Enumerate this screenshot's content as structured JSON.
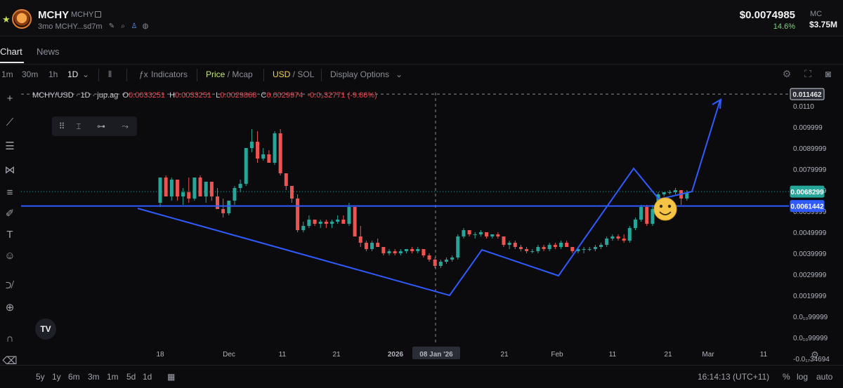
{
  "header": {
    "symbol": "MCHY",
    "symbol_sub": "MCHY",
    "age": "3mo",
    "address": "MCHY...sd7m",
    "price": "$0.0074985",
    "change": "14.6%",
    "mc_label": "MC",
    "mc_value": "$3.75M"
  },
  "tabs": [
    "Chart",
    "News"
  ],
  "toolbar": {
    "intervals": [
      "1m",
      "30m",
      "1h",
      "1D"
    ],
    "indicators": "Indicators",
    "price": "Price",
    "mcap": "Mcap",
    "usd": "USD",
    "sol": "SOL",
    "display_options": "Display Options"
  },
  "legend": {
    "title": "MCHY/USD · 1D · jup.ag",
    "o_label": "O",
    "o": "0.0033251",
    "h_label": "H",
    "h": "0.0033251",
    "l_label": "L",
    "l": "0.0029868",
    "c_label": "C",
    "c": "0.0029974",
    "chg": "-0.0₃32771 (-9.86%)"
  },
  "bottom": {
    "ranges": [
      "5y",
      "1y",
      "6m",
      "3m",
      "1m",
      "5d",
      "1d"
    ],
    "time": "16:14:13 (UTC+11)",
    "pct": "%",
    "log": "log",
    "auto": "auto"
  },
  "colors": {
    "up": "#26a69a",
    "down": "#ef5350",
    "drawing": "#2f5bff",
    "bg": "#0b0b0e"
  },
  "chart_data": {
    "type": "candlestick",
    "pair": "MCHY/USD",
    "interval": "1D",
    "y_ticks": [
      "0.0110",
      "0.009999",
      "0.0089999",
      "0.0079999",
      "0.0069999",
      "0.0059999",
      "0.0049999",
      "0.0039999",
      "0.0029999",
      "0.0019999",
      "0.0₁₀99999",
      "0.0₁₀99999",
      "-0.0₁₇34694"
    ],
    "x_ticks": [
      "18",
      "Dec",
      "11",
      "21",
      "2026",
      "08 Jan '26",
      "21",
      "Feb",
      "11",
      "21",
      "Mar",
      "11"
    ],
    "price_labels": [
      {
        "value": 0.011462,
        "text": "0.011462",
        "style": "crosshair"
      },
      {
        "value": 0.0068299,
        "text": "0.0068299",
        "style": "last"
      },
      {
        "value": 0.0061442,
        "text": "0.0061442",
        "style": "line"
      }
    ],
    "candles": [
      [
        0.0063,
        0.0075,
        0.0061,
        0.0075
      ],
      [
        0.0075,
        0.0076,
        0.0066,
        0.0066
      ],
      [
        0.0066,
        0.0075,
        0.0064,
        0.0074
      ],
      [
        0.0074,
        0.0074,
        0.0064,
        0.0066
      ],
      [
        0.0066,
        0.007,
        0.0062,
        0.0068
      ],
      [
        0.0068,
        0.0075,
        0.0063,
        0.0065
      ],
      [
        0.0065,
        0.0075,
        0.0064,
        0.0075
      ],
      [
        0.0075,
        0.0076,
        0.0066,
        0.0066
      ],
      [
        0.0066,
        0.0073,
        0.0063,
        0.0073
      ],
      [
        0.0073,
        0.0073,
        0.0064,
        0.0066
      ],
      [
        0.0066,
        0.007,
        0.006,
        0.006
      ],
      [
        0.006,
        0.0065,
        0.0056,
        0.0058
      ],
      [
        0.0058,
        0.0064,
        0.0057,
        0.0064
      ],
      [
        0.0064,
        0.0071,
        0.0062,
        0.007
      ],
      [
        0.007,
        0.0074,
        0.0068,
        0.0072
      ],
      [
        0.0072,
        0.0089,
        0.0071,
        0.0089
      ],
      [
        0.0089,
        0.0098,
        0.0087,
        0.0092
      ],
      [
        0.0092,
        0.0097,
        0.0082,
        0.0084
      ],
      [
        0.0084,
        0.0089,
        0.0083,
        0.0086
      ],
      [
        0.0086,
        0.0088,
        0.0082,
        0.0082
      ],
      [
        0.0082,
        0.0097,
        0.0081,
        0.0096
      ],
      [
        0.0096,
        0.0098,
        0.0076,
        0.0077
      ],
      [
        0.0077,
        0.0077,
        0.0069,
        0.0071
      ],
      [
        0.0071,
        0.0071,
        0.0063,
        0.0065
      ],
      [
        0.0065,
        0.0067,
        0.0049,
        0.005
      ],
      [
        0.005,
        0.0054,
        0.0049,
        0.0052
      ],
      [
        0.0052,
        0.0057,
        0.0051,
        0.0055
      ],
      [
        0.0055,
        0.0055,
        0.0052,
        0.0053
      ],
      [
        0.0053,
        0.0055,
        0.0051,
        0.0054
      ],
      [
        0.0054,
        0.0055,
        0.0051,
        0.0053
      ],
      [
        0.0053,
        0.0055,
        0.0051,
        0.0054
      ],
      [
        0.0054,
        0.0057,
        0.0053,
        0.0055
      ],
      [
        0.0055,
        0.0057,
        0.0053,
        0.0053
      ],
      [
        0.0053,
        0.0063,
        0.0052,
        0.0061
      ],
      [
        0.0061,
        0.0061,
        0.0047,
        0.0047
      ],
      [
        0.0047,
        0.0052,
        0.0042,
        0.0044
      ],
      [
        0.0044,
        0.0045,
        0.004,
        0.0041
      ],
      [
        0.0041,
        0.0045,
        0.004,
        0.0044
      ],
      [
        0.0044,
        0.0046,
        0.0042,
        0.0042
      ],
      [
        0.0042,
        0.0042,
        0.0038,
        0.0039
      ],
      [
        0.0039,
        0.0041,
        0.0038,
        0.004
      ],
      [
        0.004,
        0.0041,
        0.0038,
        0.0039
      ],
      [
        0.0039,
        0.0041,
        0.0038,
        0.004
      ],
      [
        0.004,
        0.0041,
        0.0039,
        0.0041
      ],
      [
        0.0041,
        0.0042,
        0.0039,
        0.004
      ],
      [
        0.004,
        0.0042,
        0.0039,
        0.0041
      ],
      [
        0.0041,
        0.0041,
        0.0037,
        0.0038
      ],
      [
        0.0038,
        0.0039,
        0.0035,
        0.0036
      ],
      [
        0.0036,
        0.0037,
        0.0032,
        0.0033
      ],
      [
        0.0033,
        0.0036,
        0.0032,
        0.0035
      ],
      [
        0.0035,
        0.0037,
        0.0034,
        0.0036
      ],
      [
        0.0036,
        0.0038,
        0.0035,
        0.0037
      ],
      [
        0.0037,
        0.0048,
        0.0036,
        0.0047
      ],
      [
        0.0047,
        0.0051,
        0.0046,
        0.005
      ],
      [
        0.005,
        0.005,
        0.0047,
        0.0048
      ],
      [
        0.0048,
        0.0049,
        0.0046,
        0.0048
      ],
      [
        0.0048,
        0.005,
        0.0047,
        0.0049
      ],
      [
        0.0049,
        0.0049,
        0.0046,
        0.0047
      ],
      [
        0.0047,
        0.0048,
        0.0046,
        0.0048
      ],
      [
        0.0048,
        0.0049,
        0.0046,
        0.0047
      ],
      [
        0.0047,
        0.0047,
        0.0042,
        0.0043
      ],
      [
        0.0043,
        0.0045,
        0.0041,
        0.0044
      ],
      [
        0.0044,
        0.0045,
        0.0041,
        0.0042
      ],
      [
        0.0042,
        0.0043,
        0.004,
        0.0041
      ],
      [
        0.0041,
        0.0042,
        0.0039,
        0.004
      ],
      [
        0.004,
        0.0041,
        0.0039,
        0.004
      ],
      [
        0.004,
        0.0043,
        0.0039,
        0.0042
      ],
      [
        0.0042,
        0.0043,
        0.004,
        0.0041
      ],
      [
        0.0041,
        0.0044,
        0.004,
        0.0043
      ],
      [
        0.0043,
        0.0044,
        0.0041,
        0.0042
      ],
      [
        0.0042,
        0.0045,
        0.0041,
        0.0044
      ],
      [
        0.0044,
        0.0045,
        0.0042,
        0.0042
      ],
      [
        0.0042,
        0.0042,
        0.0039,
        0.004
      ],
      [
        0.004,
        0.0042,
        0.0039,
        0.0041
      ],
      [
        0.0041,
        0.0042,
        0.0039,
        0.0041
      ],
      [
        0.0041,
        0.0042,
        0.004,
        0.0041
      ],
      [
        0.0041,
        0.0043,
        0.004,
        0.0042
      ],
      [
        0.0042,
        0.0044,
        0.0041,
        0.0043
      ],
      [
        0.0043,
        0.0047,
        0.0042,
        0.0046
      ],
      [
        0.0046,
        0.0048,
        0.0045,
        0.0047
      ],
      [
        0.0047,
        0.0048,
        0.0045,
        0.0046
      ],
      [
        0.0046,
        0.0048,
        0.0044,
        0.0045
      ],
      [
        0.0045,
        0.0052,
        0.0044,
        0.0051
      ],
      [
        0.0051,
        0.0056,
        0.005,
        0.0055
      ],
      [
        0.0055,
        0.0062,
        0.0054,
        0.0061
      ],
      [
        0.0061,
        0.0062,
        0.0052,
        0.0053
      ],
      [
        0.0053,
        0.0062,
        0.0052,
        0.006
      ],
      [
        0.006,
        0.0068,
        0.0059,
        0.0067
      ],
      [
        0.0067,
        0.0068,
        0.0066,
        0.0068
      ],
      [
        0.0068,
        0.0069,
        0.0067,
        0.0068
      ],
      [
        0.0068,
        0.007,
        0.0067,
        0.0069
      ],
      [
        0.0069,
        0.0069,
        0.0062,
        0.0065
      ],
      [
        0.0065,
        0.0069,
        0.0064,
        0.0068
      ]
    ]
  }
}
